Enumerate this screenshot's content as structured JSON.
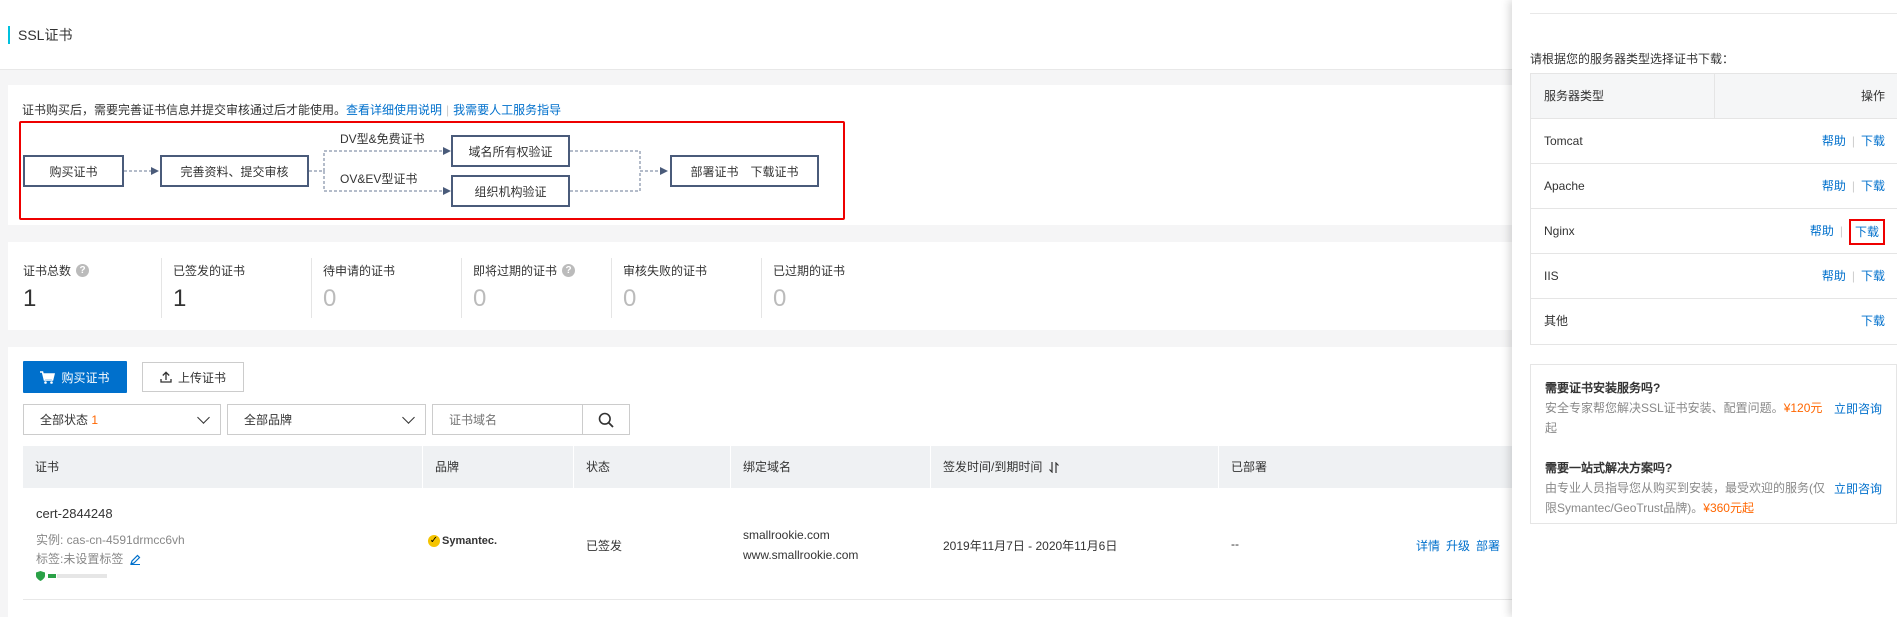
{
  "header": {
    "title": "SSL证书"
  },
  "flow": {
    "intro": "证书购买后，需要完善证书信息并提交审核通过后才能使用。",
    "link_docs": "查看详细使用说明",
    "link_help": "我需要人工服务指导",
    "step_buy": "购买证书",
    "step_submit": "完善资料、提交审核",
    "dv_label": "DV型&免费证书",
    "ov_label": "OV&EV型证书",
    "step_domain": "域名所有权验证",
    "step_org": "组织机构验证",
    "step_deploy": "部署证书　下载证书"
  },
  "stats": [
    {
      "label": "证书总数",
      "value": "1",
      "help": true
    },
    {
      "label": "已签发的证书",
      "value": "1",
      "help": false
    },
    {
      "label": "待申请的证书",
      "value": "0",
      "help": false
    },
    {
      "label": "即将过期的证书",
      "value": "0",
      "help": true
    },
    {
      "label": "审核失败的证书",
      "value": "0",
      "help": false
    },
    {
      "label": "已过期的证书",
      "value": "0",
      "help": false
    }
  ],
  "toolbar": {
    "buy_label": "购买证书",
    "upload_label": "上传证书",
    "status_select": "全部状态",
    "status_count": "1",
    "brand_select": "全部品牌",
    "search_placeholder": "证书域名"
  },
  "table": {
    "headers": [
      "证书",
      "品牌",
      "状态",
      "绑定域名",
      "签发时间/到期时间",
      "已部署"
    ],
    "row": {
      "name": "cert-2844248",
      "instance": "实例: cas-cn-4591drmcc6vh",
      "tag": "标签:未设置标签",
      "brand": "Symantec.",
      "status": "已签发",
      "domain1": "smallrookie.com",
      "domain2": "www.smallrookie.com",
      "dates": "2019年11月7日 - 2020年11月6日",
      "deployed": "--",
      "act_detail": "详情",
      "act_upgrade": "升级",
      "act_deploy": "部署"
    }
  },
  "panel": {
    "hint": "请根据您的服务器类型选择证书下载：",
    "col_type": "服务器类型",
    "col_ops": "操作",
    "help_label": "帮助",
    "download_label": "下载",
    "servers": [
      "Tomcat",
      "Apache",
      "Nginx",
      "IIS",
      "其他"
    ],
    "service1_title": "需要证书安装服务吗?",
    "service1_desc_a": "安全专家帮您解决SSL证书安装、配置问题。",
    "service1_price": "¥120元",
    "service1_desc_b": "起",
    "service1_link": "立即咨询",
    "service2_title": "需要一站式解决方案吗?",
    "service2_desc_a": "由专业人员指导您从购买到安装，最受欢迎的服务(仅限Symantec/GeoTrust品牌)。",
    "service2_price": "¥360元起",
    "service2_link": "立即咨询"
  },
  "colors": {
    "accent": "#0070cc",
    "highlight": "#ee0000",
    "price": "#ff6600"
  }
}
